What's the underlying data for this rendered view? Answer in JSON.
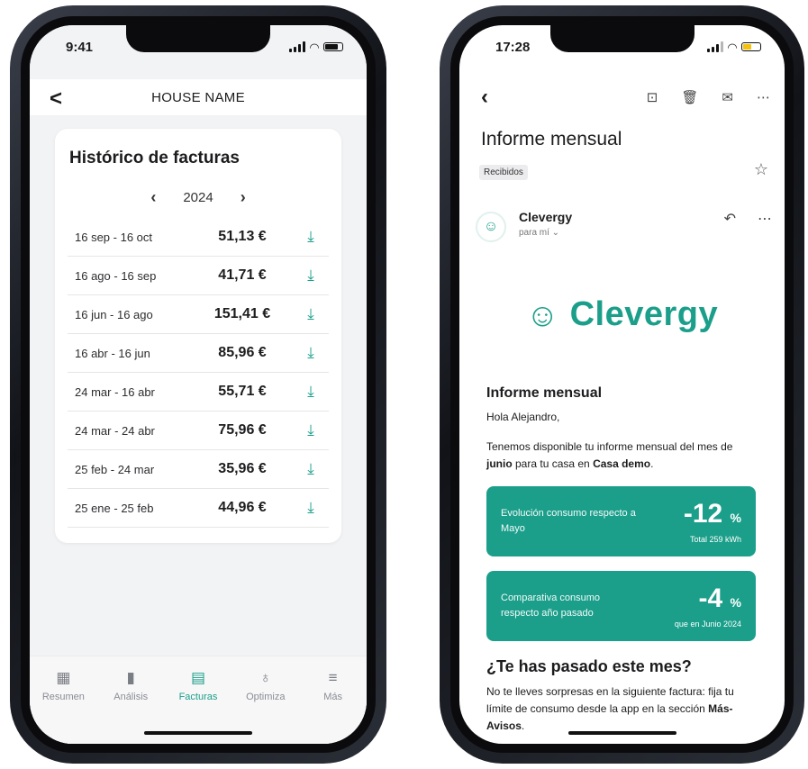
{
  "left_phone": {
    "status": {
      "time": "9:41"
    },
    "header": {
      "title": "HOUSE NAME",
      "back": "<"
    },
    "card": {
      "title": "Histórico de facturas",
      "year": "2024",
      "prev": "‹",
      "next": "›",
      "rows": [
        {
          "range": "16 sep - 16 oct",
          "amount": "51,13 €"
        },
        {
          "range": "16 ago - 16 sep",
          "amount": "41,71 €"
        },
        {
          "range": "16 jun - 16 ago",
          "amount": "151,41 €"
        },
        {
          "range": "16 abr - 16 jun",
          "amount": "85,96 €"
        },
        {
          "range": "24 mar - 16 abr",
          "amount": "55,71 €"
        },
        {
          "range": "24 mar - 24 abr",
          "amount": "75,96 €"
        },
        {
          "range": "25 feb - 24 mar",
          "amount": "35,96 €"
        },
        {
          "range": "25 ene - 25 feb",
          "amount": "44,96 €"
        }
      ]
    },
    "tabs": [
      {
        "label": "Resumen",
        "icon": "dashboard-icon",
        "glyph": "▦",
        "active": false
      },
      {
        "label": "Análisis",
        "icon": "bar-chart-icon",
        "glyph": "▮",
        "active": false
      },
      {
        "label": "Facturas",
        "icon": "invoice-icon",
        "glyph": "▤",
        "active": true
      },
      {
        "label": "Optimiza",
        "icon": "bulb-icon",
        "glyph": "♁",
        "active": false
      },
      {
        "label": "Más",
        "icon": "menu-icon",
        "glyph": "≡",
        "active": false
      }
    ],
    "accent": "#1b9f8a"
  },
  "right_phone": {
    "status": {
      "time": "17:28"
    },
    "subject": "Informe mensual",
    "label": "Recibidos",
    "sender": {
      "name": "Clevergy",
      "to": "para mí ⌄"
    },
    "logo": "Clevergy",
    "body": {
      "heading": "Informe mensual",
      "greeting": "Hola Alejandro,",
      "intro_1": "Tenemos disponible tu informe mensual  del mes de ",
      "intro_month": "junio",
      "intro_2": " para tu casa en ",
      "intro_house": "Casa demo",
      "intro_end": ".",
      "kpi1": {
        "label": "Evolución consumo respecto a Mayo",
        "value": "-12",
        "unit": "%",
        "sub": "Total 259 kWh"
      },
      "kpi2": {
        "label": "Comparativa consumo respecto año pasado",
        "value": "-4",
        "unit": "%",
        "sub": "que en Junio 2024"
      },
      "q_heading": "¿Te has pasado este mes?",
      "q_text_1": "No te lleves sorpresas en la siguiente factura: fija tu límite de consumo desde la app en la sección ",
      "q_text_bold": "Más-Avisos",
      "q_text_end": "."
    },
    "accent": "#1b9f8a"
  }
}
